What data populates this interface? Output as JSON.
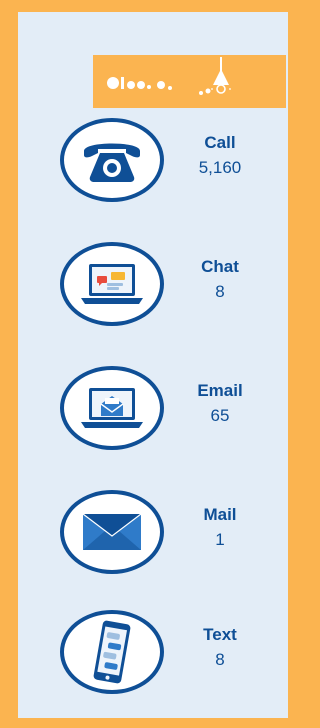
{
  "colors": {
    "frame": "#fbb450",
    "panel": "#e3edf7",
    "accent": "#0f4f96",
    "icon_light": "#2f7bc9"
  },
  "banner": {
    "logo_icon": "logo-glyph-icon",
    "lamp_icon": "lightbulb-icon"
  },
  "channels": [
    {
      "label": "Call",
      "count": "5,160",
      "icon": "telephone-icon"
    },
    {
      "label": "Chat",
      "count": "8",
      "icon": "laptop-chat-icon"
    },
    {
      "label": "Email",
      "count": "65",
      "icon": "laptop-email-icon"
    },
    {
      "label": "Mail",
      "count": "1",
      "icon": "envelope-icon"
    },
    {
      "label": "Text",
      "count": "8",
      "icon": "smartphone-icon"
    }
  ]
}
